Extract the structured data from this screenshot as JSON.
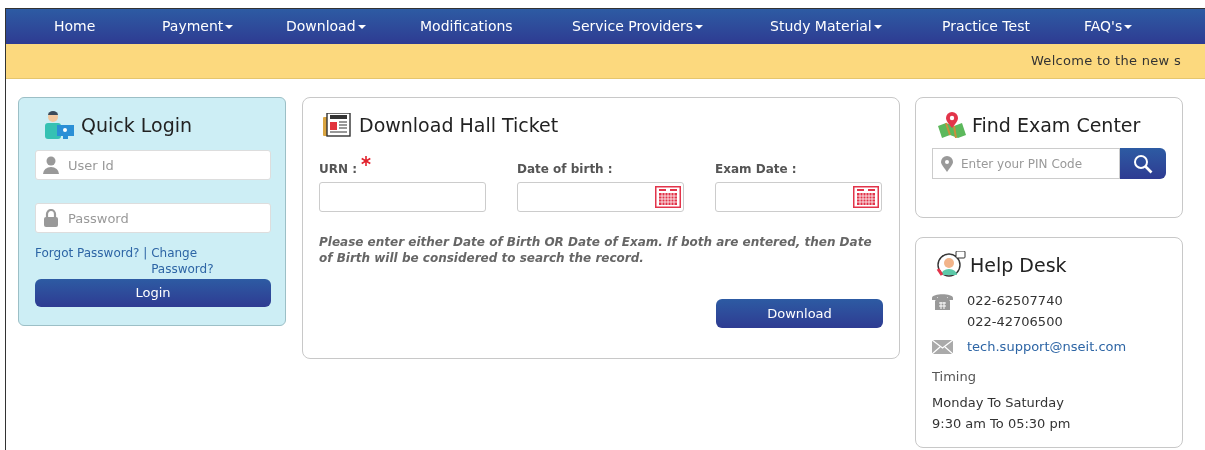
{
  "nav": [
    {
      "label": "Home",
      "has_menu": false
    },
    {
      "label": "Payment",
      "has_menu": true
    },
    {
      "label": "Download",
      "has_menu": true
    },
    {
      "label": "Modifications",
      "has_menu": false
    },
    {
      "label": "Service Providers",
      "has_menu": true
    },
    {
      "label": "Study Material",
      "has_menu": true
    },
    {
      "label": "Practice Test",
      "has_menu": false
    },
    {
      "label": "FAQ's",
      "has_menu": true
    }
  ],
  "ticker": "Welcome to the new s",
  "quick_login": {
    "title": "Quick Login",
    "user_placeholder": "User Id",
    "password_placeholder": "Password",
    "forgot_link": "Forgot Password?",
    "separator": "|",
    "change_link": "Change Password?",
    "button": "Login"
  },
  "hall_ticket": {
    "title": "Download Hall Ticket",
    "fields": [
      {
        "label": "URN :",
        "required": true,
        "calendar": false
      },
      {
        "label": "Date of birth :",
        "required": false,
        "calendar": true
      },
      {
        "label": "Exam Date :",
        "required": false,
        "calendar": true
      }
    ],
    "note": "Please enter either Date of Birth OR Date of Exam. If both are entered, then Date of Birth will be considered to search the record.",
    "button": "Download"
  },
  "exam_center": {
    "title": "Find Exam Center",
    "placeholder": "Enter your PIN Code"
  },
  "help_desk": {
    "title": "Help Desk",
    "phones": [
      "022-62507740",
      "022-42706500"
    ],
    "email": "tech.support@nseit.com",
    "timing_label": "Timing",
    "days": "Monday To Saturday",
    "hours": "9:30 am To 05:30 pm"
  }
}
